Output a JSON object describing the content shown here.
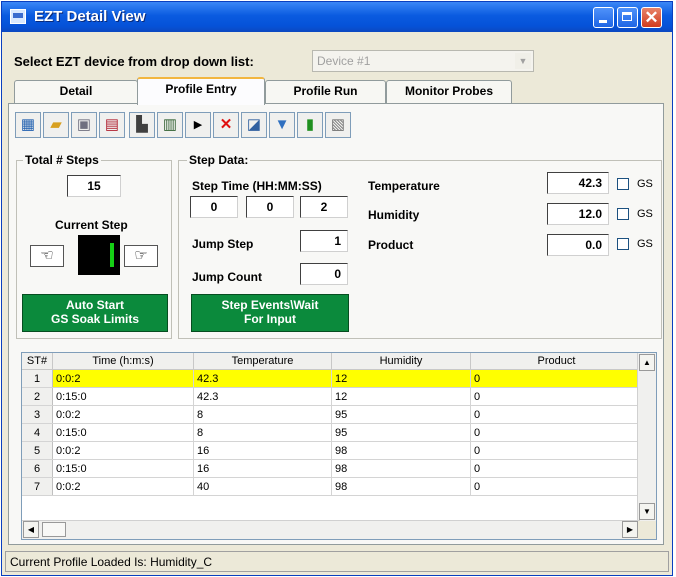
{
  "window": {
    "title": "EZT Detail View",
    "buttons": {
      "minimize": "minimize",
      "maximize": "maximize",
      "close": "✕"
    }
  },
  "device_select": {
    "label": "Select EZT device from drop down list:",
    "value": "Device #1"
  },
  "tabs": [
    {
      "label": "Detail",
      "active": false
    },
    {
      "label": "Profile Entry",
      "active": true
    },
    {
      "label": "Profile Run",
      "active": false
    },
    {
      "label": "Monitor Probes",
      "active": false
    }
  ],
  "toolbar": {
    "icons": [
      "table-icon",
      "open-folder-icon",
      "save-icon",
      "save-as-icon",
      "clear-icon",
      "edit-icon",
      "play-icon",
      "delete-icon",
      "chart-icon",
      "download-icon",
      "upload-icon",
      "print-icon"
    ]
  },
  "total_steps": {
    "label": "Total # Steps",
    "value": "15"
  },
  "current_step": {
    "label": "Current Step",
    "value": "1"
  },
  "auto_start": {
    "line1": "Auto Start",
    "line2": "GS Soak Limits"
  },
  "step_data": {
    "label": "Step Data:",
    "step_time_label": "Step Time (HH:MM:SS)",
    "hh": "0",
    "mm": "0",
    "ss": "2",
    "jump_step_label": "Jump Step",
    "jump_step": "1",
    "jump_count_label": "Jump Count",
    "jump_count": "0",
    "events_button_line1": "Step Events\\Wait",
    "events_button_line2": "For Input",
    "temperature_label": "Temperature",
    "temperature": "42.3",
    "humidity_label": "Humidity",
    "humidity": "12.0",
    "product_label": "Product",
    "product": "0.0",
    "gs_label": "GS"
  },
  "table": {
    "columns": [
      "ST#",
      "Time (h:m:s)",
      "Temperature",
      "Humidity",
      "Product"
    ],
    "rows": [
      [
        "1",
        "0:0:2",
        "42.3",
        "12",
        "0"
      ],
      [
        "2",
        "0:15:0",
        "42.3",
        "12",
        "0"
      ],
      [
        "3",
        "0:0:2",
        "8",
        "95",
        "0"
      ],
      [
        "4",
        "0:15:0",
        "8",
        "95",
        "0"
      ],
      [
        "5",
        "0:0:2",
        "16",
        "98",
        "0"
      ],
      [
        "6",
        "0:15:0",
        "16",
        "98",
        "0"
      ],
      [
        "7",
        "0:0:2",
        "40",
        "98",
        "0"
      ]
    ],
    "selected_row": 1
  },
  "status": {
    "text": "Current Profile Loaded Is: Humidity_C"
  }
}
